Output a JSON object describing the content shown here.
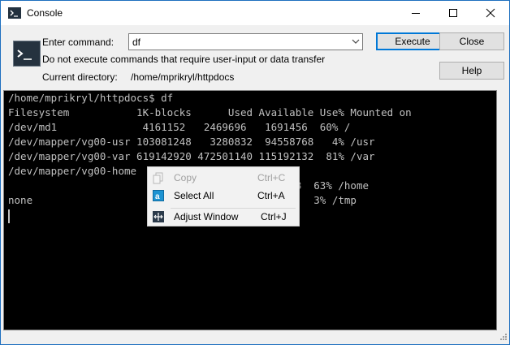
{
  "window": {
    "title": "Console"
  },
  "command_panel": {
    "enter_command_label": "Enter command:",
    "command_value": "df",
    "warning": "Do not execute commands that require user-input or data transfer",
    "current_dir_label": "Current directory:",
    "current_dir_value": "/home/mprikryl/httpdocs",
    "execute_label": "Execute",
    "close_label": "Close",
    "help_label": "Help"
  },
  "console": {
    "lines": [
      "/home/mprikryl/httpdocs$ df",
      "Filesystem           1K-blocks      Used Available Use% Mounted on",
      "/dev/md1              4161152   2469696   1691456  60% /",
      "/dev/mapper/vg00-usr 103081248   3280832  94558768   4% /usr",
      "/dev/mapper/vg00-var 619142920 472501140 115192132  81% /var",
      "/dev/mapper/vg00-home",
      "                                           56768  63% /home",
      "none                                      47128   3% /tmp"
    ]
  },
  "context_menu": {
    "items": [
      {
        "label": "Copy",
        "shortcut": "Ctrl+C",
        "icon": "copy-icon",
        "enabled": false
      },
      {
        "label": "Select All",
        "shortcut": "Ctrl+A",
        "icon": "select-all-icon",
        "enabled": true
      },
      {
        "label": "Adjust Window",
        "shortcut": "Ctrl+J",
        "icon": "adjust-window-icon",
        "enabled": true
      }
    ]
  },
  "colors": {
    "console_bg": "#000000",
    "console_fg": "#c0c0c0",
    "accent": "#0078d7"
  }
}
